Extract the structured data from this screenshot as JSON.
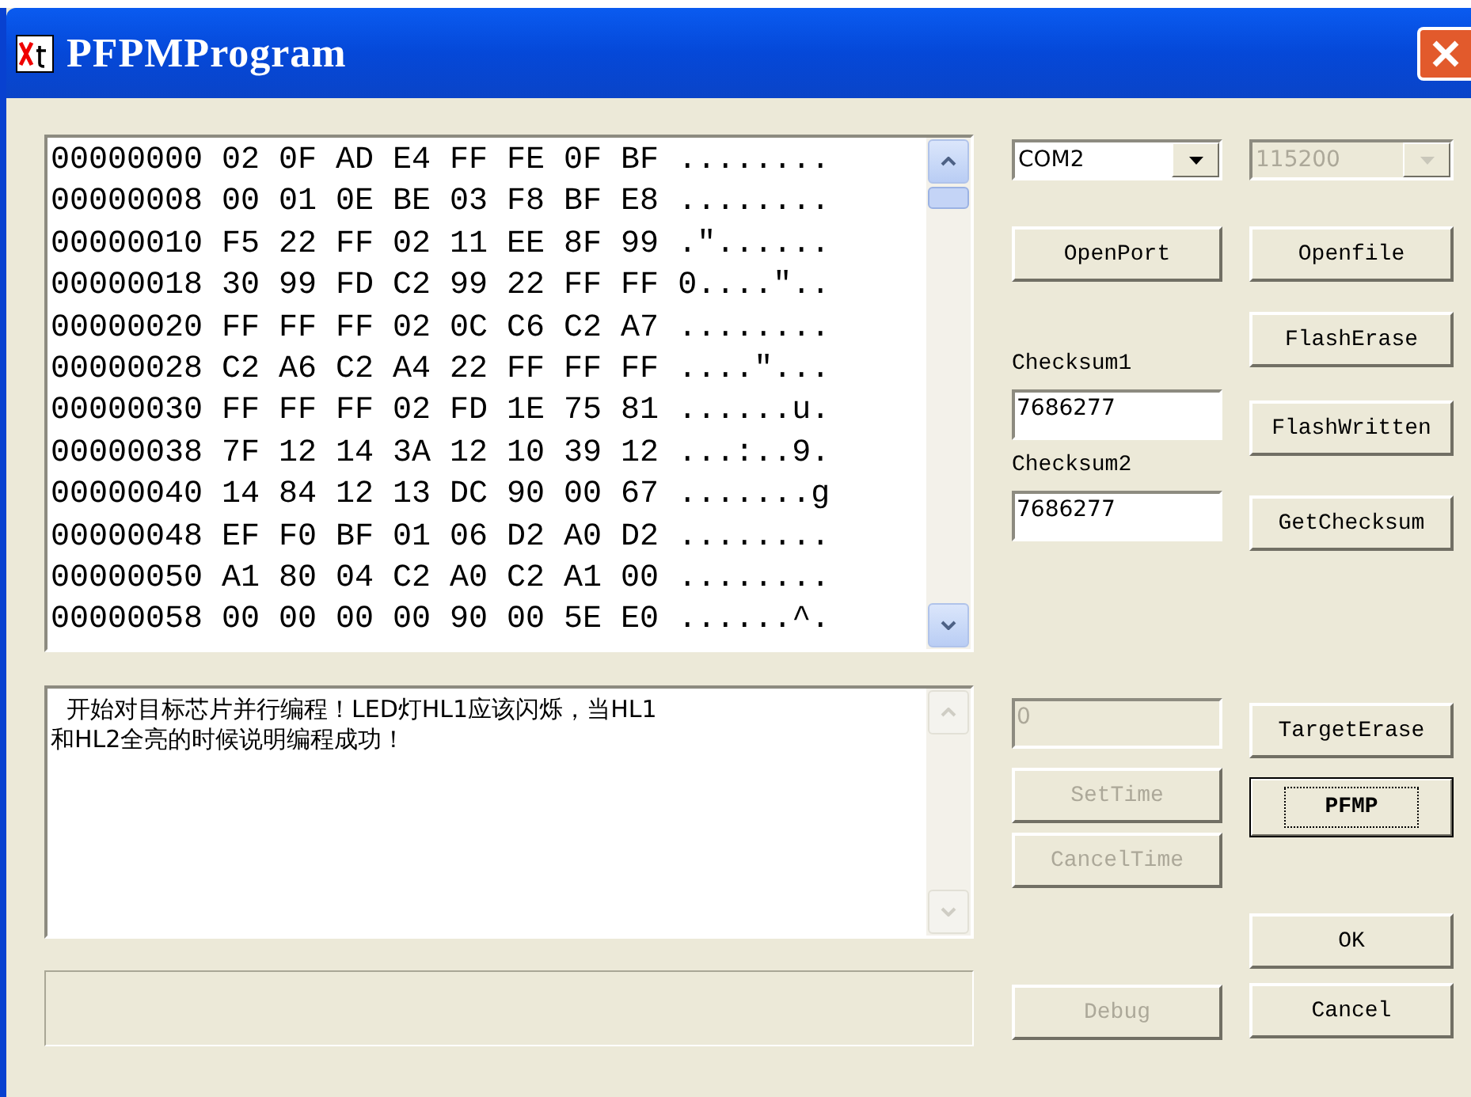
{
  "window": {
    "title": "PFPMProgram"
  },
  "hex_view": {
    "lines": [
      "00000000 02 0F AD E4 FF FE 0F BF ........",
      "00000008 00 01 0E BE 03 F8 BF E8 ........",
      "00000010 F5 22 FF 02 11 EE 8F 99 .\"......",
      "00000018 30 99 FD C2 99 22 FF FF 0....\"..",
      "00000020 FF FF FF 02 0C C6 C2 A7 ........",
      "00000028 C2 A6 C2 A4 22 FF FF FF ....\"...",
      "00000030 FF FF FF 02 FD 1E 75 81 ......u.",
      "00000038 7F 12 14 3A 12 10 39 12 ...:..9.",
      "00000040 14 84 12 13 DC 90 00 67 .......g",
      "00000048 EF F0 BF 01 06 D2 A0 D2 ........",
      "00000050 A1 80 04 C2 A0 C2 A1 00 ........",
      "00000058 00 00 00 00 90 00 5E E0 ......^."
    ]
  },
  "message_log": {
    "lines": [
      "开始对目标芯片并行编程！LED灯HL1应该闪烁，当HL1",
      "和HL2全亮的时候说明编程成功！"
    ]
  },
  "port_select": {
    "value": "COM2",
    "disabled": false
  },
  "baud_select": {
    "value": "115200",
    "disabled": true
  },
  "buttons": [
    {
      "kind": "open_port",
      "label": "OpenPort",
      "disabled": false,
      "default": false
    },
    {
      "kind": "open_file",
      "label": "Openfile",
      "disabled": false,
      "default": false
    },
    {
      "kind": "flash_erase",
      "label": "FlashErase",
      "disabled": false,
      "default": false
    },
    {
      "kind": "flash_written",
      "label": "FlashWritten",
      "disabled": false,
      "default": false
    },
    {
      "kind": "get_checksum",
      "label": "GetChecksum",
      "disabled": false,
      "default": false
    },
    {
      "kind": "target_erase",
      "label": "TargetErase",
      "disabled": false,
      "default": false
    },
    {
      "kind": "set_time",
      "label": "SetTime",
      "disabled": true,
      "default": false
    },
    {
      "kind": "pfmp",
      "label": "PFMP",
      "disabled": false,
      "default": true
    },
    {
      "kind": "cancel_time",
      "label": "CancelTime",
      "disabled": true,
      "default": false
    },
    {
      "kind": "ok",
      "label": "OK",
      "disabled": false,
      "default": false
    },
    {
      "kind": "debug",
      "label": "Debug",
      "disabled": true,
      "default": false
    },
    {
      "kind": "cancel",
      "label": "Cancel",
      "disabled": false,
      "default": false
    }
  ],
  "checksums": [
    {
      "label": "Checksum1",
      "value": "7686277"
    },
    {
      "label": "Checksum2",
      "value": "7686277"
    }
  ],
  "time_field": {
    "value": "0",
    "disabled": true
  }
}
